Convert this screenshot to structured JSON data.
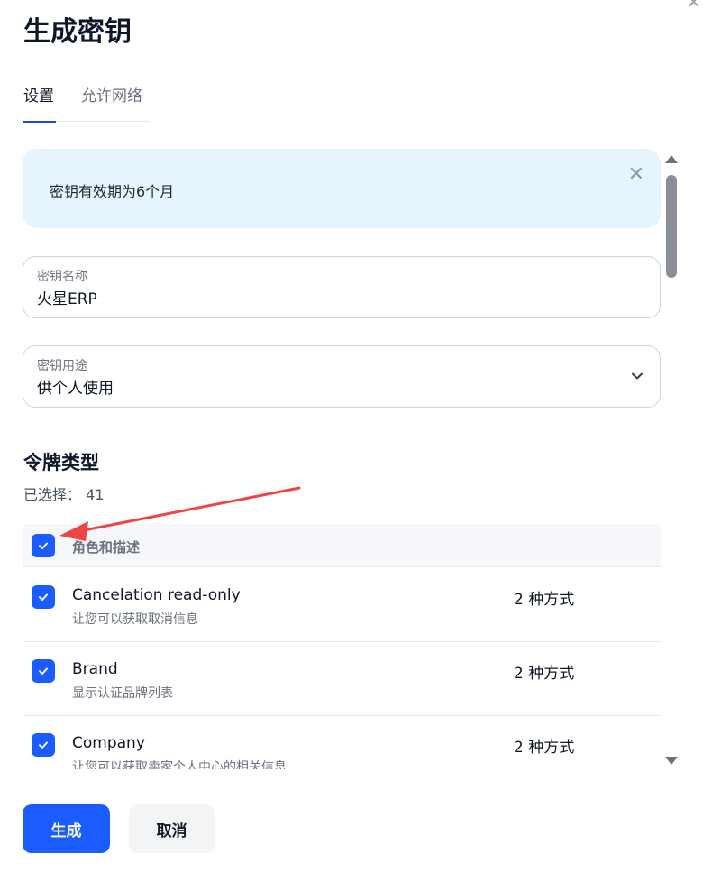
{
  "dialog": {
    "title": "生成密钥",
    "close_icon": "close-icon",
    "close_glyph": "✕"
  },
  "tabs": [
    {
      "label": "设置",
      "active": true
    },
    {
      "label": "允许网络",
      "active": false
    }
  ],
  "notice": {
    "text": "密钥有效期为6个月",
    "close_glyph": "✕"
  },
  "fields": {
    "key_name": {
      "label": "密钥名称",
      "value": "火星ERP"
    },
    "key_usage": {
      "label": "密钥用途",
      "value": "供个人使用"
    }
  },
  "token_types": {
    "title": "令牌类型",
    "selected_label": "已选择：",
    "selected_count": "41",
    "header_label": "角色和描述",
    "rows": [
      {
        "title": "Cancelation read-only",
        "desc": "让您可以获取取消信息",
        "methods": "2 种方式",
        "checked": true
      },
      {
        "title": "Brand",
        "desc": "显示认证品牌列表",
        "methods": "2 种方式",
        "checked": true
      },
      {
        "title": "Company",
        "desc": "让您可以获取卖家个人中心的相关信息",
        "methods": "2 种方式",
        "checked": true
      }
    ]
  },
  "buttons": {
    "generate": "生成",
    "cancel": "取消"
  },
  "colors": {
    "accent": "#1a5cff",
    "notice_bg": "#e6f4fd",
    "annotation_arrow": "#ef4444"
  }
}
